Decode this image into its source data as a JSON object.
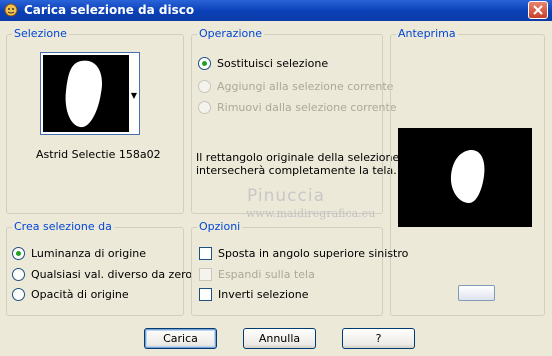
{
  "window": {
    "title": "Carica selezione da disco"
  },
  "selezione": {
    "legend": "Selezione",
    "thumb_name": "Astrid Selectie 158a02"
  },
  "operazione": {
    "legend": "Operazione",
    "options": [
      {
        "label": "Sostituisci selezione",
        "checked": true,
        "enabled": true
      },
      {
        "label": "Aggiungi alla selezione corrente",
        "checked": false,
        "enabled": false
      },
      {
        "label": "Rimuovi dalla selezione corrente",
        "checked": false,
        "enabled": false
      }
    ],
    "note_line1": "Il rettangolo originale della selezione",
    "note_line2": "intersecherà completamente la tela."
  },
  "anteprima": {
    "legend": "Anteprima"
  },
  "crea": {
    "legend": "Crea selezione da",
    "options": [
      {
        "label": "Luminanza di origine",
        "checked": true
      },
      {
        "label": "Qualsiasi val. diverso da zero",
        "checked": false
      },
      {
        "label": "Opacità di origine",
        "checked": false
      }
    ]
  },
  "opzioni": {
    "legend": "Opzioni",
    "options": [
      {
        "label": "Sposta in angolo superiore sinistro",
        "checked": false,
        "enabled": true
      },
      {
        "label": "Espandi sulla tela",
        "checked": false,
        "enabled": false
      },
      {
        "label": "Inverti selezione",
        "checked": false,
        "enabled": true
      }
    ]
  },
  "watermark": {
    "name": "Pinuccia",
    "url": "www.maidiregrafica.eu"
  },
  "buttons": {
    "ok": "Carica",
    "cancel": "Annulla",
    "help": "?"
  },
  "colors": {
    "accent": "#0046d5",
    "titlebar": "#0a3fb6",
    "face": "#ece9d8"
  }
}
